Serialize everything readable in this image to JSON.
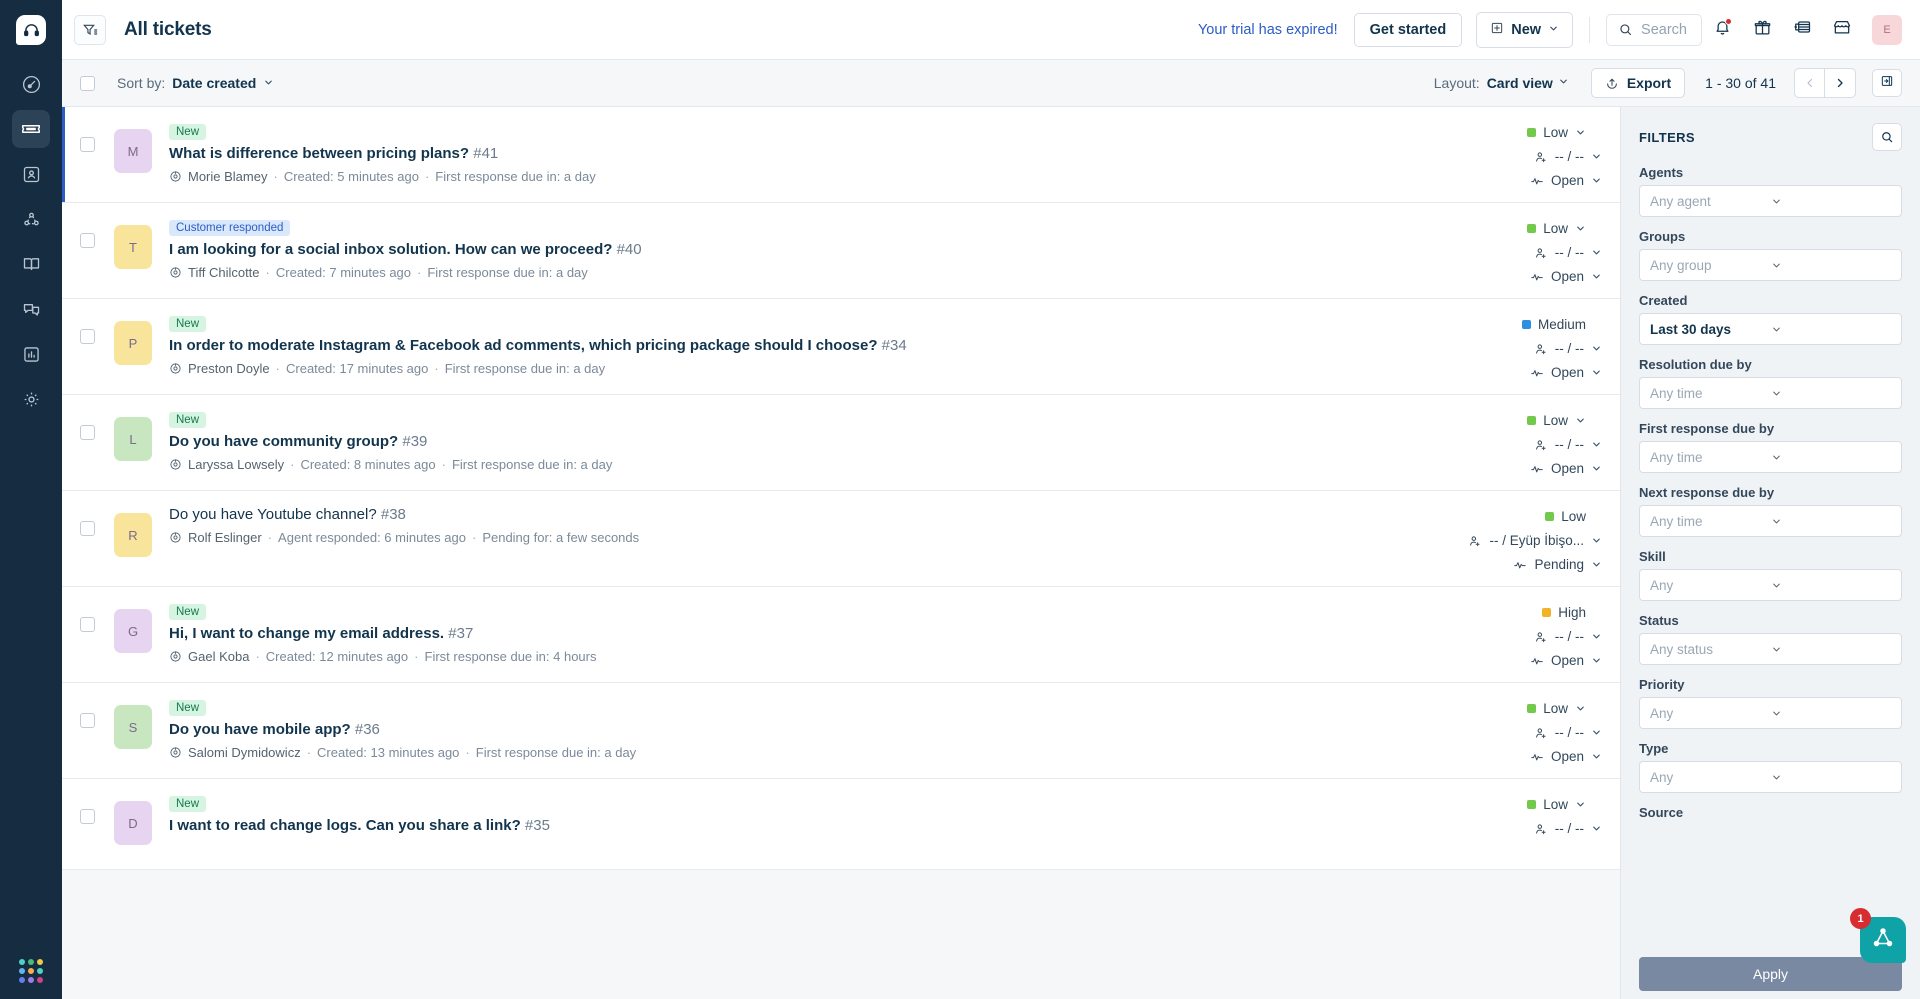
{
  "sidebar": {
    "logo_icon": "headset-logo-icon",
    "items": [
      {
        "name": "dashboard",
        "icon": "gauge-icon",
        "active": false
      },
      {
        "name": "tickets",
        "icon": "ticket-icon",
        "active": true
      },
      {
        "name": "contacts",
        "icon": "contact-card-icon",
        "active": false
      },
      {
        "name": "customers",
        "icon": "network-nodes-icon",
        "active": false
      },
      {
        "name": "knowledge-base",
        "icon": "book-icon",
        "active": false
      },
      {
        "name": "conversations",
        "icon": "chat-bubbles-icon",
        "active": false
      },
      {
        "name": "analytics",
        "icon": "bar-chart-icon",
        "active": false
      },
      {
        "name": "admin",
        "icon": "gear-icon",
        "active": false
      }
    ],
    "launcher_icon": "app-grid-icon",
    "launcher_colors": [
      "#4fd1c5",
      "#48bb78",
      "#ecc94b",
      "#63b3ed",
      "#f6ad55",
      "#4fd1c5",
      "#667eea",
      "#9f7aea",
      "#d53f8c"
    ]
  },
  "header": {
    "filter_toggle_icon": "filter-list-icon",
    "title": "All tickets",
    "trial_notice": "Your trial has expired!",
    "get_started_label": "Get started",
    "new_label": "New",
    "new_icon": "plus-square-icon",
    "search_placeholder": "Search",
    "search_icon": "search-icon",
    "notifications_icon": "bell-icon",
    "has_notification_dot": true,
    "gift_icon": "gift-icon",
    "news_icon": "news-feed-icon",
    "marketplace_icon": "marketplace-store-icon",
    "avatar_initial": "E",
    "avatar_bg": "#f8d7da"
  },
  "toolbar": {
    "select_all_checkbox": false,
    "sort_label": "Sort by:",
    "sort_value": "Date created",
    "layout_label": "Layout:",
    "layout_value": "Card view",
    "export_label": "Export",
    "export_icon": "export-up-icon",
    "pagination_text": "1 - 30 of 41",
    "prev_icon": "chevron-left-icon",
    "next_icon": "chevron-right-icon",
    "prev_disabled": true,
    "panel_toggle_icon": "side-panel-icon"
  },
  "priority_colors": {
    "Low": "#73c94b",
    "Medium": "#2c8fdf",
    "High": "#f0b429"
  },
  "tickets": [
    {
      "tag": "New",
      "tag_type": "new",
      "unread": true,
      "avatar_initial": "M",
      "avatar_bg": "#e7d4f0",
      "title": "What is difference between pricing plans?",
      "number": "#41",
      "requester": "Morie Blamey",
      "time": "Created: 5 minutes ago",
      "due": "First response due in: a day",
      "priority": "Low",
      "priority_chevron": true,
      "agent": "-- / --",
      "agent_chevron": true,
      "status": "Open",
      "status_chevron": true,
      "bold_title": true
    },
    {
      "tag": "Customer responded",
      "tag_type": "customer",
      "unread": false,
      "avatar_initial": "T",
      "avatar_bg": "#f8e59b",
      "title": "I am looking for a social inbox solution. How can we proceed?",
      "number": "#40",
      "requester": "Tiff Chilcotte",
      "time": "Created: 7 minutes ago",
      "due": "First response due in: a day",
      "priority": "Low",
      "priority_chevron": true,
      "agent": "-- / --",
      "agent_chevron": true,
      "status": "Open",
      "status_chevron": true,
      "bold_title": true
    },
    {
      "tag": "New",
      "tag_type": "new",
      "unread": false,
      "avatar_initial": "P",
      "avatar_bg": "#f8e59b",
      "title": "In order to moderate Instagram & Facebook ad comments, which pricing package should I choose?",
      "number": "#34",
      "requester": "Preston Doyle",
      "time": "Created: 17 minutes ago",
      "due": "First response due in: a day",
      "priority": "Medium",
      "priority_chevron": false,
      "agent": "-- / --",
      "agent_chevron": true,
      "status": "Open",
      "status_chevron": true,
      "bold_title": true
    },
    {
      "tag": "New",
      "tag_type": "new",
      "unread": false,
      "avatar_initial": "L",
      "avatar_bg": "#c8e6c0",
      "title": "Do you have community group?",
      "number": "#39",
      "requester": "Laryssa Lowsely",
      "time": "Created: 8 minutes ago",
      "due": "First response due in: a day",
      "priority": "Low",
      "priority_chevron": true,
      "agent": "-- / --",
      "agent_chevron": true,
      "status": "Open",
      "status_chevron": true,
      "bold_title": true
    },
    {
      "tag": "",
      "tag_type": "",
      "unread": false,
      "avatar_initial": "R",
      "avatar_bg": "#f8e59b",
      "title": "Do you have Youtube channel?",
      "number": "#38",
      "requester": "Rolf Eslinger",
      "time": "Agent responded: 6 minutes ago",
      "due": "Pending for: a few seconds",
      "priority": "Low",
      "priority_chevron": false,
      "agent": "-- / Eyüp İbişo...",
      "agent_chevron": true,
      "status": "Pending",
      "status_chevron": true,
      "bold_title": false
    },
    {
      "tag": "New",
      "tag_type": "new",
      "unread": false,
      "avatar_initial": "G",
      "avatar_bg": "#e7d4f0",
      "title": "Hi, I want to change my email address.",
      "number": "#37",
      "requester": "Gael Koba",
      "time": "Created: 12 minutes ago",
      "due": "First response due in: 4 hours",
      "priority": "High",
      "priority_chevron": false,
      "agent": "-- / --",
      "agent_chevron": true,
      "status": "Open",
      "status_chevron": true,
      "bold_title": true
    },
    {
      "tag": "New",
      "tag_type": "new",
      "unread": false,
      "avatar_initial": "S",
      "avatar_bg": "#c8e6c0",
      "title": "Do you have mobile app?",
      "number": "#36",
      "requester": "Salomi Dymidowicz",
      "time": "Created: 13 minutes ago",
      "due": "First response due in: a day",
      "priority": "Low",
      "priority_chevron": true,
      "agent": "-- / --",
      "agent_chevron": true,
      "status": "Open",
      "status_chevron": true,
      "bold_title": true
    },
    {
      "tag": "New",
      "tag_type": "new",
      "unread": false,
      "avatar_initial": "D",
      "avatar_bg": "#e7d4f0",
      "title": "I want to read change logs. Can you share a link?",
      "number": "#35",
      "requester": "",
      "time": "",
      "due": "",
      "priority": "Low",
      "priority_chevron": true,
      "agent": "-- / --",
      "agent_chevron": true,
      "status": "",
      "status_chevron": false,
      "bold_title": true
    }
  ],
  "filters": {
    "title": "FILTERS",
    "search_icon": "search-icon",
    "groups": [
      {
        "label": "Agents",
        "value": "Any agent",
        "filled": false
      },
      {
        "label": "Groups",
        "value": "Any group",
        "filled": false
      },
      {
        "label": "Created",
        "value": "Last 30 days",
        "filled": true
      },
      {
        "label": "Resolution due by",
        "value": "Any time",
        "filled": false
      },
      {
        "label": "First response due by",
        "value": "Any time",
        "filled": false
      },
      {
        "label": "Next response due by",
        "value": "Any time",
        "filled": false
      },
      {
        "label": "Skill",
        "value": "Any",
        "filled": false
      },
      {
        "label": "Status",
        "value": "Any status",
        "filled": false
      },
      {
        "label": "Priority",
        "value": "Any",
        "filled": false
      },
      {
        "label": "Type",
        "value": "Any",
        "filled": false
      },
      {
        "label": "Source",
        "value": "",
        "filled": false
      }
    ],
    "apply_label": "Apply"
  },
  "fab": {
    "badge_count": "1",
    "icon": "freddy-triangle-icon",
    "color": "#0fa3a8"
  }
}
